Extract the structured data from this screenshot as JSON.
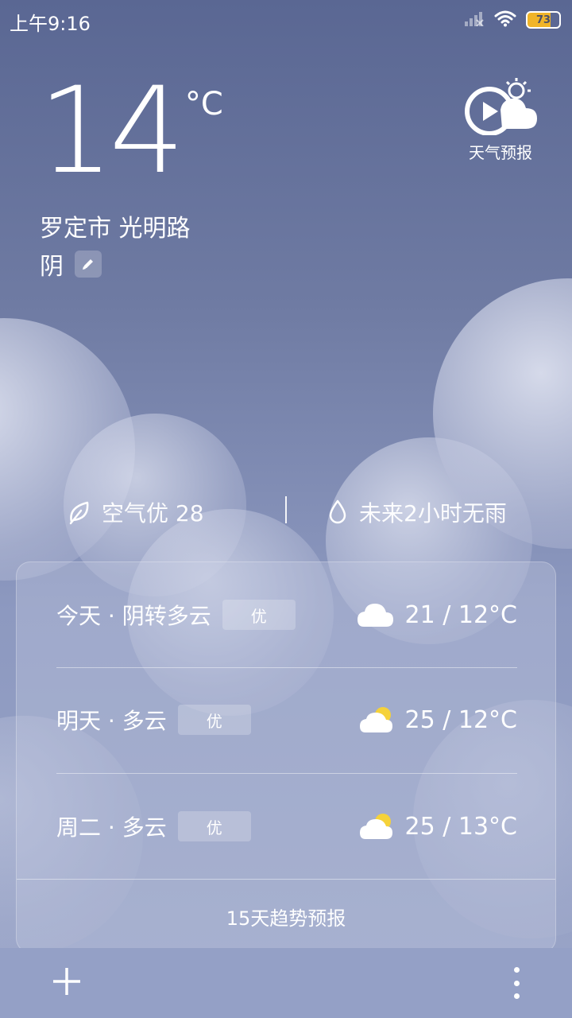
{
  "status_bar": {
    "time": "上午9:16",
    "battery_level": "73",
    "icons": [
      "signal-icon",
      "wifi-icon",
      "battery-icon"
    ]
  },
  "current": {
    "temperature": "14",
    "unit": "°C",
    "location": "罗定市 光明路",
    "condition": "阴"
  },
  "forecast_video": {
    "label": "天气预报",
    "icon": "weather-video-icon"
  },
  "metrics": {
    "air_quality": "空气优 28",
    "rain": "未来2小时无雨"
  },
  "daily": [
    {
      "label": "今天 · 阴转多云",
      "aqi": "优",
      "icon": "cloudy-icon",
      "temp": "21 / 12°C"
    },
    {
      "label": "明天 · 多云",
      "aqi": "优",
      "icon": "partly-cloudy-icon",
      "temp": "25 / 12°C"
    },
    {
      "label": "周二 · 多云",
      "aqi": "优",
      "icon": "partly-cloudy-icon",
      "temp": "25 / 13°C"
    }
  ],
  "trend_link": "15天趋势预报",
  "colors": {
    "sun": "#f5d23a",
    "battery": "#f0b429",
    "bottom_bar": "#94a0c6"
  }
}
